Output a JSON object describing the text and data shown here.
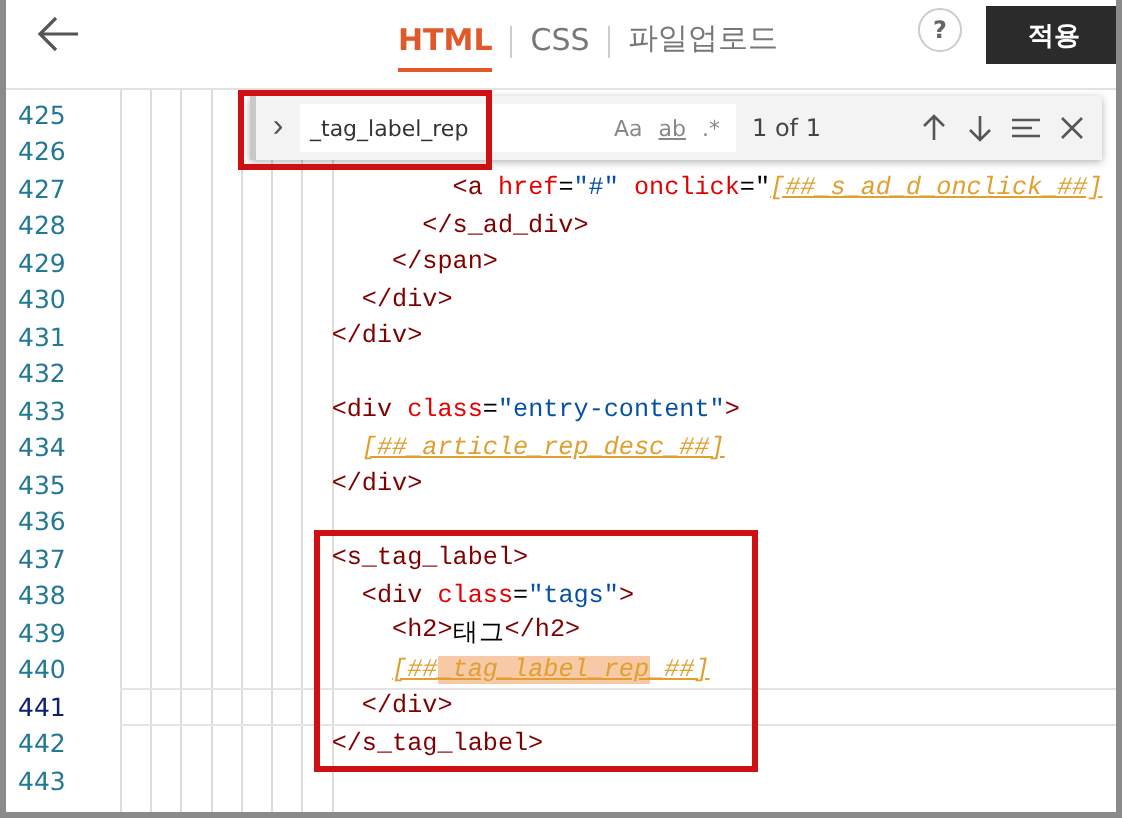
{
  "header": {
    "tabs": [
      {
        "label": "HTML",
        "selected": true
      },
      {
        "label": "CSS",
        "selected": false
      },
      {
        "label": "파일업로드",
        "selected": false
      }
    ],
    "help": "?",
    "apply_button": "적용"
  },
  "find": {
    "toggle": "›",
    "value": "_tag_label_rep",
    "options": [
      "Aa",
      "ab",
      ".*"
    ],
    "result": "1 of 1"
  },
  "lines": [
    {
      "number": "425",
      "current": false
    },
    {
      "number": "426",
      "current": false
    },
    {
      "number": "427",
      "current": false,
      "tokens": [
        {
          "kind": "tag",
          "text": "                      <a"
        },
        {
          "kind": "attr",
          "text": " href"
        },
        {
          "kind": "punct",
          "text": "="
        },
        {
          "kind": "value",
          "text": "\"#\""
        },
        {
          "kind": "attr",
          "text": " onclick"
        },
        {
          "kind": "punct",
          "text": "=\""
        },
        {
          "kind": "placeholder",
          "text": "[##_s_ad_d_onclick_##]"
        }
      ]
    },
    {
      "number": "428",
      "current": false,
      "tokens": [
        {
          "kind": "tag",
          "text": "                    </s_ad_div>"
        }
      ]
    },
    {
      "number": "429",
      "current": false,
      "tokens": [
        {
          "kind": "tag",
          "text": "                  </span>"
        }
      ]
    },
    {
      "number": "430",
      "current": false,
      "tokens": [
        {
          "kind": "tag",
          "text": "                </div>"
        }
      ]
    },
    {
      "number": "431",
      "current": false,
      "tokens": [
        {
          "kind": "tag",
          "text": "              </div>"
        }
      ]
    },
    {
      "number": "432",
      "current": false
    },
    {
      "number": "433",
      "current": false,
      "tokens": [
        {
          "kind": "tag",
          "text": "              <div"
        },
        {
          "kind": "attr",
          "text": " class"
        },
        {
          "kind": "punct",
          "text": "="
        },
        {
          "kind": "value",
          "text": "\"entry-content\""
        },
        {
          "kind": "tag",
          "text": ">"
        }
      ]
    },
    {
      "number": "434",
      "current": false,
      "tokens": [
        {
          "kind": "placeholder",
          "text": "                [##_article_rep_desc_##]"
        }
      ]
    },
    {
      "number": "435",
      "current": false,
      "tokens": [
        {
          "kind": "tag",
          "text": "              </div>"
        }
      ]
    },
    {
      "number": "436",
      "current": false
    },
    {
      "number": "437",
      "current": false,
      "tokens": [
        {
          "kind": "tag",
          "text": "              <s_tag_label>"
        }
      ]
    },
    {
      "number": "438",
      "current": false,
      "tokens": [
        {
          "kind": "tag",
          "text": "                <div"
        },
        {
          "kind": "attr",
          "text": " class"
        },
        {
          "kind": "punct",
          "text": "="
        },
        {
          "kind": "value",
          "text": "\"tags\""
        },
        {
          "kind": "tag",
          "text": ">"
        }
      ]
    },
    {
      "number": "439",
      "current": false,
      "tokens": [
        {
          "kind": "tag",
          "text": "                  <h2>"
        },
        {
          "kind": "text",
          "text": "태그"
        },
        {
          "kind": "tag",
          "text": "</h2>"
        }
      ]
    },
    {
      "number": "440",
      "current": false,
      "tokens": [
        {
          "kind": "placeholder",
          "text": "                  [##"
        },
        {
          "kind": "match",
          "text": "_tag_label_rep"
        },
        {
          "kind": "placeholder",
          "text": "_##]"
        }
      ]
    },
    {
      "number": "441",
      "current": true,
      "tokens": [
        {
          "kind": "tag",
          "text": "                </div>"
        }
      ]
    },
    {
      "number": "442",
      "current": false,
      "tokens": [
        {
          "kind": "tag",
          "text": "              </s_tag_label>"
        }
      ]
    },
    {
      "number": "443",
      "current": false
    }
  ]
}
